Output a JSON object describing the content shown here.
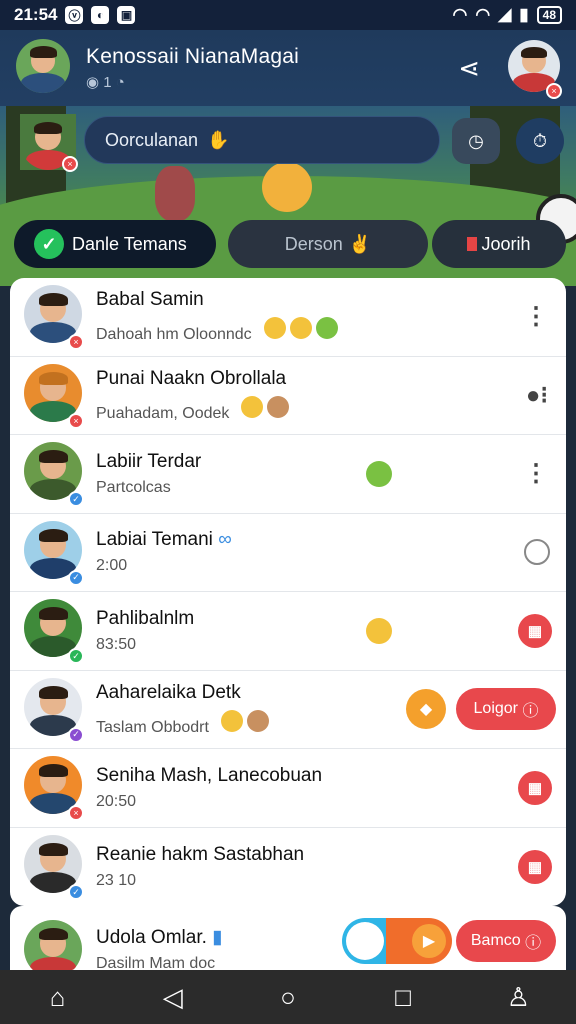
{
  "status": {
    "time": "21:54",
    "battery": "48"
  },
  "header": {
    "title": "Kenossaii NianaMagai",
    "subtitle": "1"
  },
  "search": {
    "placeholder": "Oorculanan"
  },
  "tabs": [
    {
      "label": "Danle Temans"
    },
    {
      "label": "Derson"
    },
    {
      "label": "Joorih"
    }
  ],
  "contacts": [
    {
      "name": "Babal Samin",
      "message": "Dahoah hm Oloonndc",
      "badge_color": "#e84b4b"
    },
    {
      "name": "Punai Naakn Obrollala",
      "message": "Puahadam, Oodek",
      "badge_color": "#e84b4b"
    },
    {
      "name": "Labiir Terdar",
      "message": "Partcolcas",
      "badge_color": "#3a8de0"
    },
    {
      "name": "Labiai Temani",
      "message": "2:00",
      "badge_color": "#3a8de0"
    },
    {
      "name": "Pahlibalnlm",
      "message": "83:50",
      "badge_color": "#29b658"
    },
    {
      "name": "Aaharelaika Detk",
      "message": "Taslam Obbodrt",
      "badge_color": "#8a4dd1",
      "button": "Loigor"
    },
    {
      "name": "Seniha Mash, Lanecobuan",
      "message": "20:50",
      "badge_color": "#e84b4b"
    },
    {
      "name": "Reanie hakm Sastabhan",
      "message": "23 10",
      "badge_color": "#3a8de0"
    }
  ],
  "bottom_card": {
    "name": "Udola Omlar.",
    "message": "Dasilm Mam doc",
    "button": "Bamco"
  },
  "colors": {
    "accent_red": "#e8484c",
    "accent_green": "#25c15c",
    "header_bg": "#1f3a5c"
  },
  "icons": {
    "share": "share-icon",
    "home": "home-icon",
    "back": "back-icon",
    "recents": "recents-icon",
    "profile": "profile-icon"
  }
}
